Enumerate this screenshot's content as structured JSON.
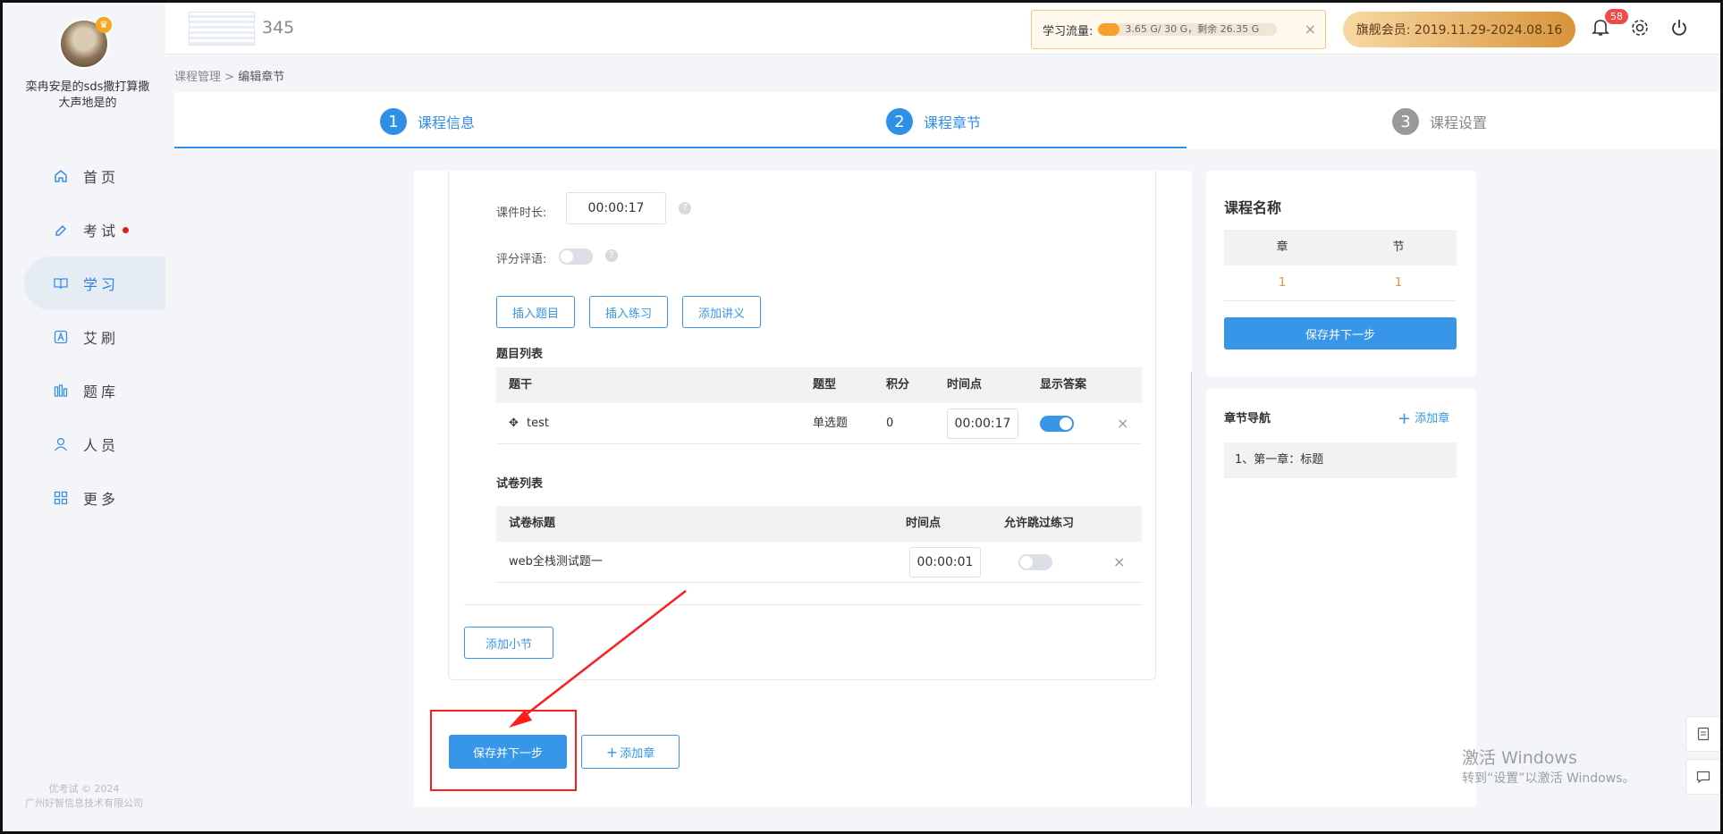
{
  "user": {
    "name": "栾冉安是的sds撒打算撒大声地是的"
  },
  "nav": {
    "items": [
      {
        "label": "首页",
        "icon": "home-icon"
      },
      {
        "label": "考试",
        "icon": "exam-icon",
        "badge_dot": true
      },
      {
        "label": "学习",
        "icon": "book-icon",
        "active": true
      },
      {
        "label": "艾刷",
        "icon": "a-icon"
      },
      {
        "label": "题库",
        "icon": "bank-icon"
      },
      {
        "label": "人员",
        "icon": "user-icon"
      },
      {
        "label": "更多",
        "icon": "more-icon"
      }
    ]
  },
  "footer": {
    "line1": "优考试 © 2024",
    "line2": "广州好智信息技术有限公司"
  },
  "header": {
    "title": "345",
    "flow_label": "学习流量:",
    "flow_text": "3.65 G/ 30 G，剩余 26.35 G",
    "flow_used_ratio": 0.12,
    "flow_close": "×",
    "member": "旗舰会员:  2019.11.29-2024.08.16",
    "notifications": "58"
  },
  "breadcrumb": {
    "parent": "课程管理",
    "sep": ">",
    "current": "编辑章节"
  },
  "steps": [
    {
      "num": "1",
      "label": "课程信息"
    },
    {
      "num": "2",
      "label": "课程章节"
    },
    {
      "num": "3",
      "label": "课程设置"
    }
  ],
  "form": {
    "duration_label": "课件时长:",
    "duration_value": "00:00:17",
    "comment_label": "评分评语:",
    "help": "?",
    "btn_insert_question": "插入题目",
    "btn_insert_practice": "插入练习",
    "btn_add_handout": "添加讲义"
  },
  "questions": {
    "title": "题目列表",
    "columns": [
      "题干",
      "题型",
      "积分",
      "时间点",
      "显示答案"
    ],
    "rows": [
      {
        "stem": "test",
        "type": "单选题",
        "score": "0",
        "time": "00:00:17",
        "show_answer": true
      }
    ]
  },
  "papers": {
    "title": "试卷列表",
    "columns": [
      "试卷标题",
      "时间点",
      "允许跳过练习"
    ],
    "rows": [
      {
        "title": "web全栈测试题一",
        "time": "00:00:01",
        "allow_skip": false
      }
    ]
  },
  "actions": {
    "add_section": "添加小节",
    "save_next": "保存并下一步",
    "add_chapter": "添加章"
  },
  "course_panel": {
    "title": "课程名称",
    "columns": [
      "章",
      "节"
    ],
    "values": [
      "1",
      "1"
    ],
    "save_next": "保存并下一步"
  },
  "chapter_nav": {
    "title": "章节导航",
    "add": "添加章",
    "items": [
      "1、第一章：标题"
    ]
  },
  "watermark": {
    "line1": "激活 Windows",
    "line2": "转到“设置”以激活 Windows。"
  },
  "close_x": "×"
}
